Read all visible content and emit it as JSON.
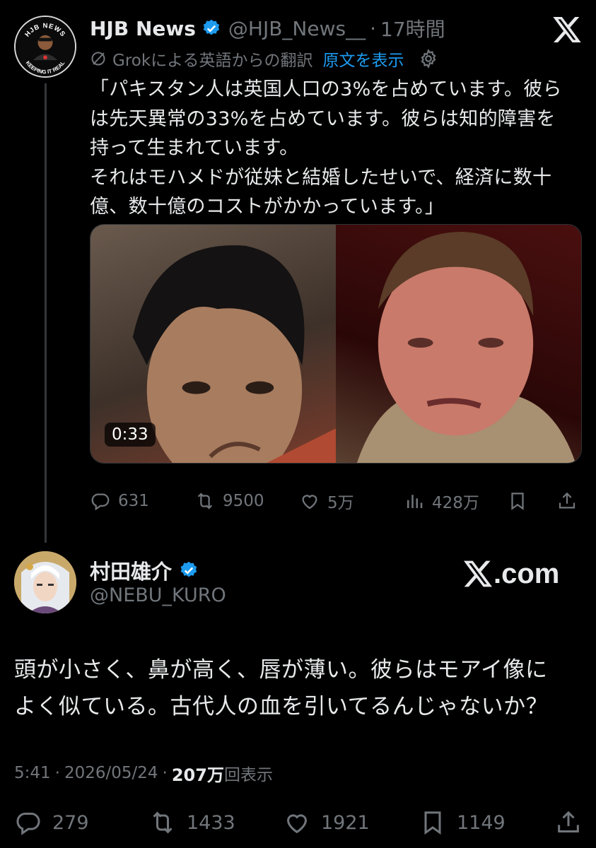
{
  "quoted_post": {
    "display_name": "HJB News",
    "handle": "@HJB_News__",
    "separator": "·",
    "time": "17時間",
    "avatar_text_top": "HJB NEWS",
    "avatar_text_bottom": "KEEPING IT REAL",
    "translation_label": "Grokによる英語からの翻訳",
    "show_original": "原文を表示",
    "text": "「パキスタン人は英国人口の3%を占めています。彼ら\nは先天異常の33%を占めています。彼らは知的障害を\n持って生まれています。\nそれはモハメドが従妹と結婚したせいで、経済に数十\n億、数十億のコストがかかっています。」",
    "video_duration": "0:33",
    "replies": "631",
    "reposts": "9500",
    "likes": "5万",
    "views": "428万"
  },
  "main_post": {
    "display_name": "村田雄介",
    "handle": "@NEBU_KURO",
    "watermark": ".com",
    "text": "頭が小さく、鼻が高く、唇が薄い。彼らはモアイ像に\nよく似ている。古代人の血を引いてるんじゃないか？",
    "time": "5:41",
    "date": "2026/05/24",
    "separator": "·",
    "views_count": "207万",
    "views_label": "回表示",
    "replies": "279",
    "reposts": "1433",
    "likes": "1921",
    "bookmarks": "1149"
  },
  "colors": {
    "background": "#000000",
    "text_primary": "#e7e9ea",
    "text_secondary": "#71767b",
    "link": "#1d9bf0",
    "verified": "#1d9bf0"
  },
  "icons": [
    "x-logo-icon",
    "verified-badge-icon",
    "grok-translate-icon",
    "gear-icon",
    "reply-icon",
    "repost-icon",
    "like-icon",
    "views-icon",
    "bookmark-icon",
    "share-icon"
  ]
}
